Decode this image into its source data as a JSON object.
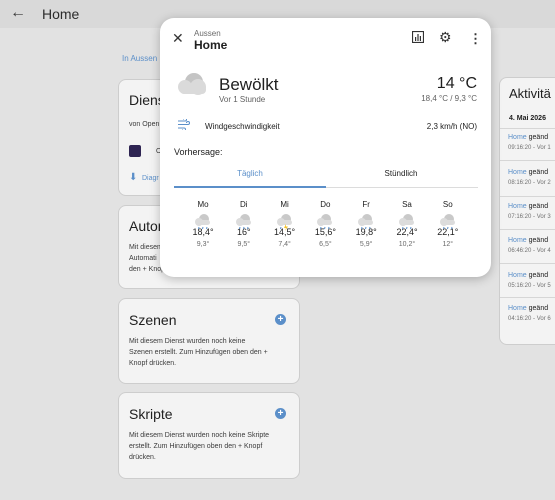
{
  "header": {
    "title": "Home"
  },
  "breadcrumb": "In Aussen",
  "cards": {
    "diensts": {
      "title": "Dienst",
      "by": "von Open",
      "item": "O",
      "diag": "Diagr"
    },
    "automations": {
      "title": "Autom",
      "text1": "Mit diesem",
      "text2": "Automati",
      "text3": "den + Knop"
    },
    "scenes": {
      "title": "Szenen",
      "text1": "Mit diesem Dienst wurden noch keine",
      "text2": "Szenen erstellt. Zum Hinzufügen oben den +",
      "text3": "Knopf drücken."
    },
    "scripts": {
      "title": "Skripte",
      "text1": "Mit diesem Dienst wurden noch keine Skripte",
      "text2": "erstellt. Zum Hinzufügen oben den + Knopf",
      "text3": "drücken."
    }
  },
  "activity": {
    "title": "Aktivitä",
    "date": "4. Mai 2026",
    "entries": [
      {
        "link": "Home",
        "text": "geänd",
        "time": "09:16:20 - Vor 1"
      },
      {
        "link": "Home",
        "text": "geänd",
        "time": "08:16:20 - Vor 2"
      },
      {
        "link": "Home",
        "text": "geänd",
        "time": "07:16:20 - Vor 3"
      },
      {
        "link": "Home",
        "text": "geänd",
        "time": "06:46:20 - Vor 4"
      },
      {
        "link": "Home",
        "text": "geänd",
        "time": "05:16:20 - Vor 5"
      },
      {
        "link": "Home",
        "text": "geänd",
        "time": "04:16:20 - Vor 6"
      }
    ]
  },
  "dialog": {
    "subtitle": "Aussen",
    "title": "Home",
    "condition": "Bewölkt",
    "updated": "Vor 1 Stunde",
    "temperature": "14 °C",
    "temp_range": "18,4 °C / 9,3 °C",
    "wind_label": "Windgeschwindigkeit",
    "wind_value": "2,3 km/h (NO)",
    "forecast_label": "Vorhersage:",
    "tabs": [
      "Täglich",
      "Stündlich"
    ],
    "days": [
      {
        "day": "Mo",
        "hi": "18,4°",
        "lo": "9,3°",
        "icon": "rainy"
      },
      {
        "day": "Di",
        "hi": "16°",
        "lo": "9,5°",
        "icon": "rainy"
      },
      {
        "day": "Mi",
        "hi": "14,5°",
        "lo": "7,4°",
        "icon": "lightning-rainy"
      },
      {
        "day": "Do",
        "hi": "15,6°",
        "lo": "6,5°",
        "icon": "rainy"
      },
      {
        "day": "Fr",
        "hi": "19,8°",
        "lo": "5,9°",
        "icon": "rainy"
      },
      {
        "day": "Sa",
        "hi": "22,4°",
        "lo": "10,2°",
        "icon": "rainy"
      },
      {
        "day": "So",
        "hi": "22,1°",
        "lo": "12°",
        "icon": "rainy"
      }
    ]
  },
  "colors": {
    "accent": "#5b8fc9"
  }
}
